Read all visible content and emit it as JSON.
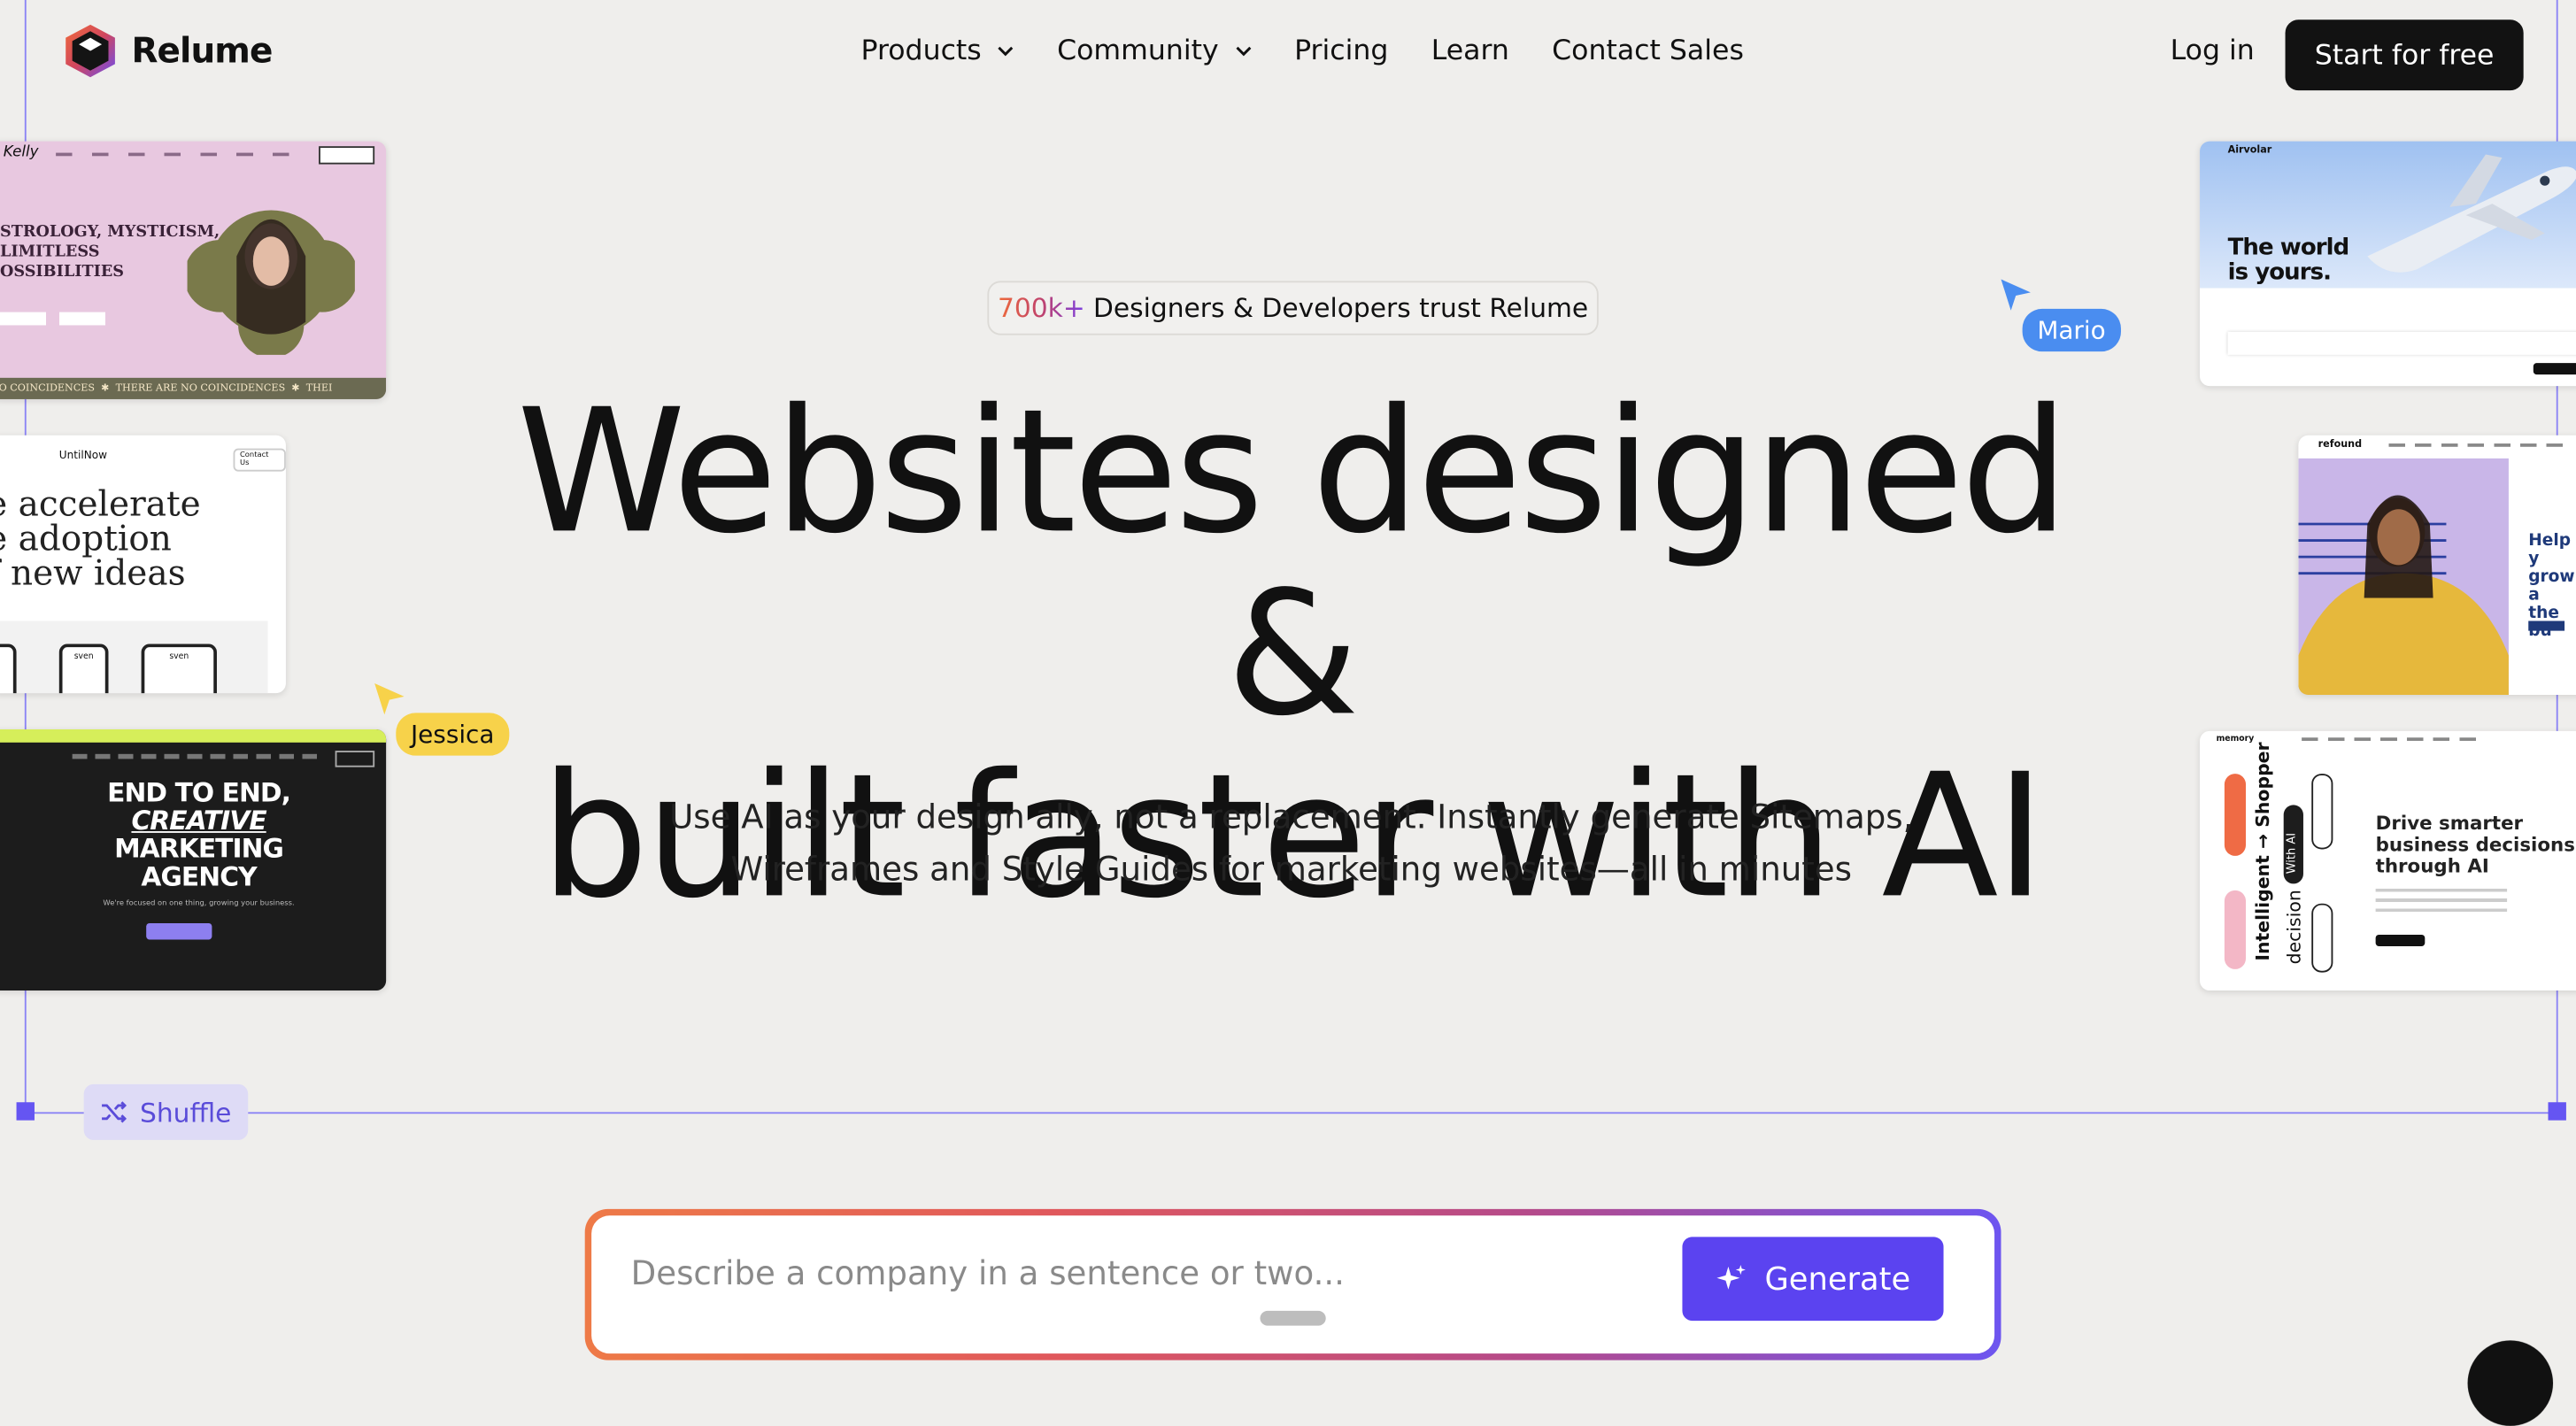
{
  "brand": {
    "name": "Relume"
  },
  "nav": {
    "items": [
      {
        "label": "Products",
        "dropdown": true
      },
      {
        "label": "Community",
        "dropdown": true
      },
      {
        "label": "Pricing",
        "dropdown": false
      },
      {
        "label": "Learn",
        "dropdown": false
      },
      {
        "label": "Contact Sales",
        "dropdown": false
      }
    ],
    "login_label": "Log in",
    "cta_label": "Start for free"
  },
  "hero": {
    "trust_count": "700k+",
    "trust_text": "Designers & Developers trust Relume",
    "headline_line1": "Websites designed &",
    "headline_line2": "built faster with AI",
    "subheadline_line1": "Use AI as your design ally, not a replacement. Instantly generate Sitemaps,",
    "subheadline_line2": "Wireframes and Style Guides for marketing websites—all in minutes"
  },
  "cursors": [
    {
      "name": "Mario",
      "color": "#4a8df0"
    },
    {
      "name": "Jessica",
      "color": "#f7d24a"
    }
  ],
  "shuffle_label": "Shuffle",
  "prompt": {
    "placeholder": "Describe a company in a sentence or two...",
    "button_label": "Generate"
  },
  "previews": {
    "astrology": {
      "logo": "Kelly",
      "heading_lines": [
        "STROLOGY, MYSTICISM,",
        "LIMITLESS",
        "OSSIBILITIES"
      ],
      "ticker": [
        "NO COINCIDENCES",
        "THERE ARE NO COINCIDENCES",
        "THEI"
      ]
    },
    "untilnow": {
      "logo": "UntilNow",
      "nav_button": "Contact Us",
      "heading_lines": [
        "e accelerate",
        "e adoption",
        "f new ideas"
      ],
      "phone_label": "sven"
    },
    "agency": {
      "heading_lines": [
        "END TO END,",
        "CREATIVE",
        "MARKETING",
        "AGENCY"
      ],
      "tagline": "We're focused on one thing, growing your business."
    },
    "airvolar": {
      "logo": "Airvolar",
      "heading_lines": [
        "The world",
        "is yours."
      ]
    },
    "refound": {
      "logo": "refound",
      "heading_lines": [
        "Help y",
        "grow a",
        "the bu"
      ]
    },
    "memory": {
      "logo": "memory",
      "vertical_words": [
        "Intelligent",
        "Shopper",
        "decision",
        "With AI"
      ],
      "heading_lines": [
        "Drive smarter",
        "business decisions",
        "through AI"
      ]
    }
  },
  "colors": {
    "accent": "#5b43f0",
    "frame": "#8b83f5",
    "background": "#efeeec"
  }
}
